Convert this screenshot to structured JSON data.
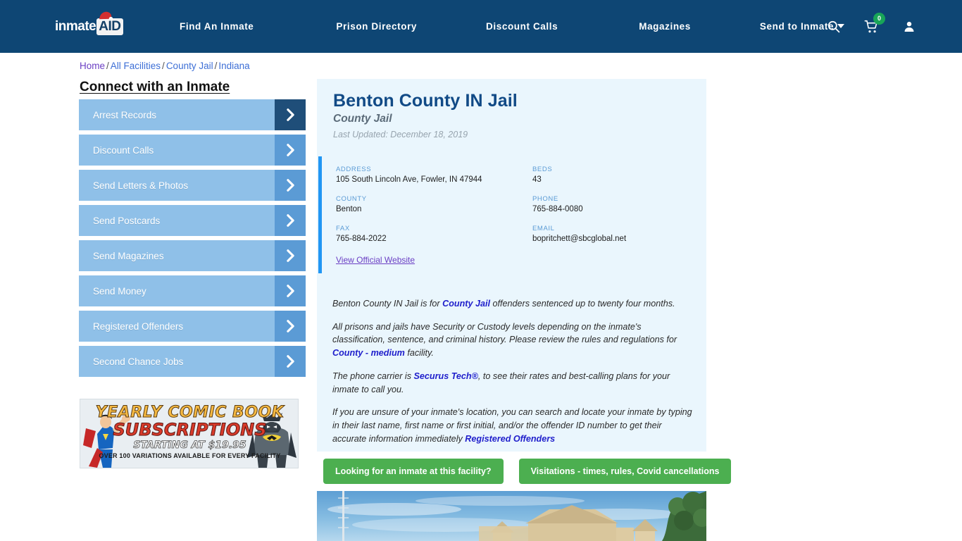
{
  "nav": {
    "logo_primary": "inmate",
    "logo_secondary": "AID",
    "links": [
      {
        "label": "Find An Inmate"
      },
      {
        "label": "Prison Directory"
      },
      {
        "label": "Discount Calls"
      },
      {
        "label": "Magazines"
      },
      {
        "label": "Send to Inmate"
      }
    ],
    "search_icon": "search-icon",
    "cart_icon": "cart-icon",
    "cart_count": "0",
    "account_icon": "user-icon",
    "bg_color": "#0e4674"
  },
  "breadcrumb": {
    "items": [
      {
        "label": "Home"
      },
      {
        "label": "All Facilities"
      },
      {
        "label": "County Jail"
      },
      {
        "label": "Indiana"
      }
    ],
    "separator": "/"
  },
  "sidebar": {
    "title": "Connect with an Inmate",
    "items": [
      {
        "label": "Arrest Records"
      },
      {
        "label": "Discount Calls"
      },
      {
        "label": "Send Letters & Photos"
      },
      {
        "label": "Send Postcards"
      },
      {
        "label": "Send Magazines"
      },
      {
        "label": "Send Money"
      },
      {
        "label": "Registered Offenders"
      },
      {
        "label": "Second Chance Jobs"
      }
    ],
    "button_color": "#8fc0e8",
    "arrow_color": "#5b9bd5",
    "arrow_active_color": "#1f4e79"
  },
  "ad": {
    "line1": "YEARLY COMIC BOOK",
    "line2": "SUBSCRIPTIONS",
    "line3": "STARTING AT $19.95",
    "line4": "OVER 100 VARIATIONS AVAILABLE FOR EVERY FACILITY"
  },
  "facility": {
    "title": "Benton County IN Jail",
    "subtitle": "County Jail",
    "last_updated": "Last Updated: December 18, 2019",
    "accent_color": "#2196f3",
    "card_bg": "#eaf6fd",
    "info_left": [
      {
        "label": "ADDRESS",
        "value": "105 South Lincoln Ave, Fowler, IN 47944"
      },
      {
        "label": "COUNTY",
        "value": "Benton"
      },
      {
        "label": "FAX",
        "value": "765-884-2022"
      }
    ],
    "info_right": [
      {
        "label": "BEDS",
        "value": "43"
      },
      {
        "label": "PHONE",
        "value": "765-884-0080"
      },
      {
        "label": "EMAIL",
        "value": "bopritchett@sbcglobal.net"
      }
    ],
    "official_website_link": "View Official Website"
  },
  "description": {
    "p1_a": "Benton County IN Jail is for ",
    "p1_link": "County Jail",
    "p1_b": " offenders sentenced up to twenty four months.",
    "p2_a": "All prisons and jails have Security or Custody levels depending on the inmate's classification, sentence, and criminal history. Please review the rules and regulations for ",
    "p2_link": "County - medium",
    "p2_b": " facility.",
    "p3_a": "The phone carrier is ",
    "p3_link": "Securus Tech®",
    "p3_b": ", to see their rates and best-calling plans for your inmate to call you.",
    "p4_a": "If you are unsure of your inmate's location, you can search and locate your inmate by typing in their last name, first name or first initial, and/or the offender ID number to get their accurate information immediately ",
    "p4_link": "Registered Offenders",
    "p4_b": ""
  },
  "actions": {
    "inmate_search_label": "Looking for an inmate at this facility?",
    "visitation_label": "Visitations - times, rules, Covid cancellations",
    "button_color": "#4caf50"
  },
  "photo": {
    "caption": "facility-exterior-photo"
  }
}
